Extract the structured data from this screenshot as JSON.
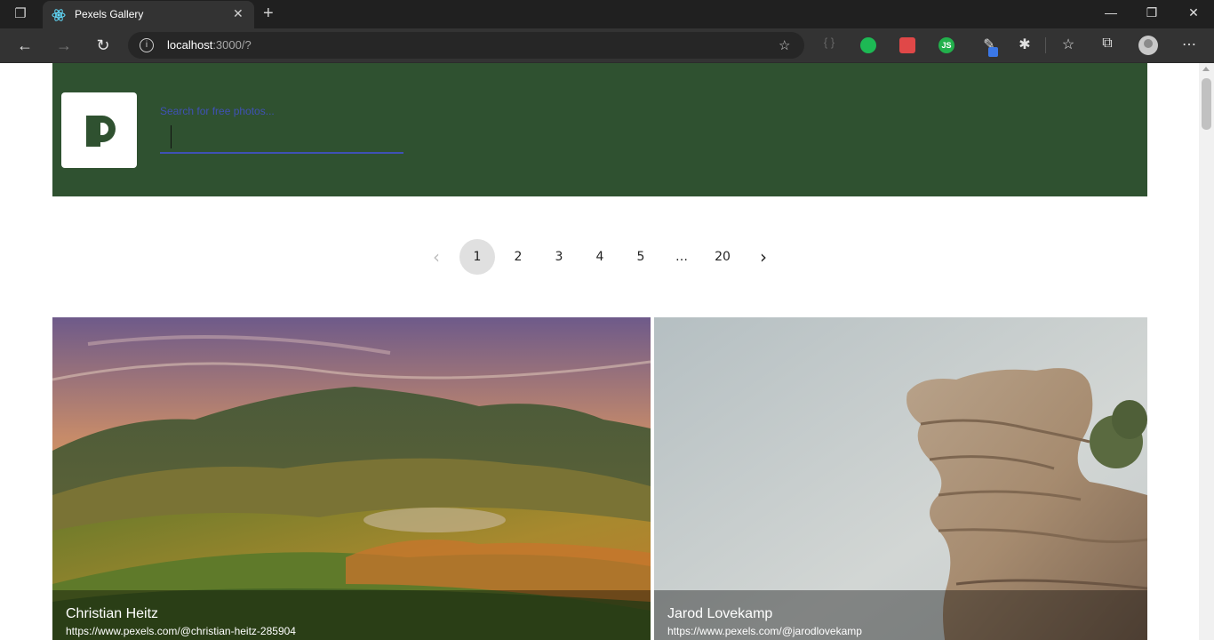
{
  "browser": {
    "tab_title": "Pexels Gallery",
    "url_host": "localhost",
    "url_path": ":3000/?",
    "icons": [
      "tab-actions-icon",
      "react-favicon-icon",
      "close-icon",
      "new-tab-icon",
      "minimize-icon",
      "restore-icon",
      "window-close-icon",
      "back-icon",
      "forward-icon",
      "refresh-icon",
      "info-icon",
      "add-favorite-icon",
      "json-ext-icon",
      "spotify-ext-icon",
      "bug-ext-icon",
      "js-ext-icon",
      "color-picker-ext-icon",
      "extensions-icon",
      "favorites-icon",
      "collections-icon",
      "profile-icon",
      "more-icon"
    ]
  },
  "header": {
    "search_label": "Search for free photos...",
    "search_value": ""
  },
  "pagination": {
    "prev": "‹",
    "pages": [
      "1",
      "2",
      "3",
      "4",
      "5",
      "…",
      "20"
    ],
    "current": "1",
    "next": "›"
  },
  "photos": [
    {
      "photographer": "Christian Heitz",
      "url": "https://www.pexels.com/@christian-heitz-285904"
    },
    {
      "photographer": "Jarod Lovekamp",
      "url": "https://www.pexels.com/@jarodlovekamp"
    }
  ],
  "colors": {
    "header_bg": "#2f5130",
    "accent": "#3f51b5"
  }
}
